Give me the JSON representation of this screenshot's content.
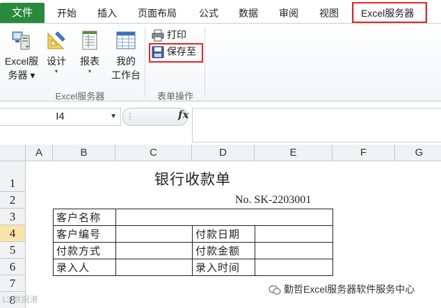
{
  "tabs": {
    "file": "文件",
    "home": "开始",
    "insert": "插入",
    "page_layout": "页面布局",
    "formulas": "公式",
    "data": "数据",
    "review": "审阅",
    "view": "视图",
    "excel_server": "Excel服务器"
  },
  "ribbon": {
    "excel_server_btn": {
      "line1": "Excel服",
      "line2": "务器"
    },
    "design_btn": "设计",
    "report_btn": "报表",
    "my_workspace_btn": {
      "line1": "我的",
      "line2": "工作台"
    },
    "group1_label": "Excel服务器",
    "print_btn": "打印",
    "save_to_btn": "保存至",
    "group2_label": "表单操作"
  },
  "formula_bar": {
    "name_box": "I4",
    "fx_label": "fx",
    "formula": ""
  },
  "grid": {
    "columns": [
      "A",
      "B",
      "C",
      "D",
      "E",
      "F",
      "G"
    ],
    "rows": [
      "1",
      "2",
      "3",
      "4",
      "5",
      "6",
      "7",
      "8"
    ],
    "selected_column": "I",
    "selected_row": "4"
  },
  "sheet": {
    "title": "银行收款单",
    "doc_no": "No. SK-2203001",
    "form": [
      [
        "客户名称",
        "",
        "",
        ""
      ],
      [
        "客户编号",
        "",
        "付款日期",
        ""
      ],
      [
        "付款方式",
        "",
        "付款金额",
        ""
      ],
      [
        "录入人",
        "",
        "录入时间",
        ""
      ]
    ]
  },
  "watermark": {
    "text": "勤哲Excel服务器软件服务中心",
    "faint": "12 数据港"
  },
  "colors": {
    "file_tab": "#2a8a3c",
    "highlight": "#e8231f",
    "header_selected": "#fbe4a8"
  }
}
